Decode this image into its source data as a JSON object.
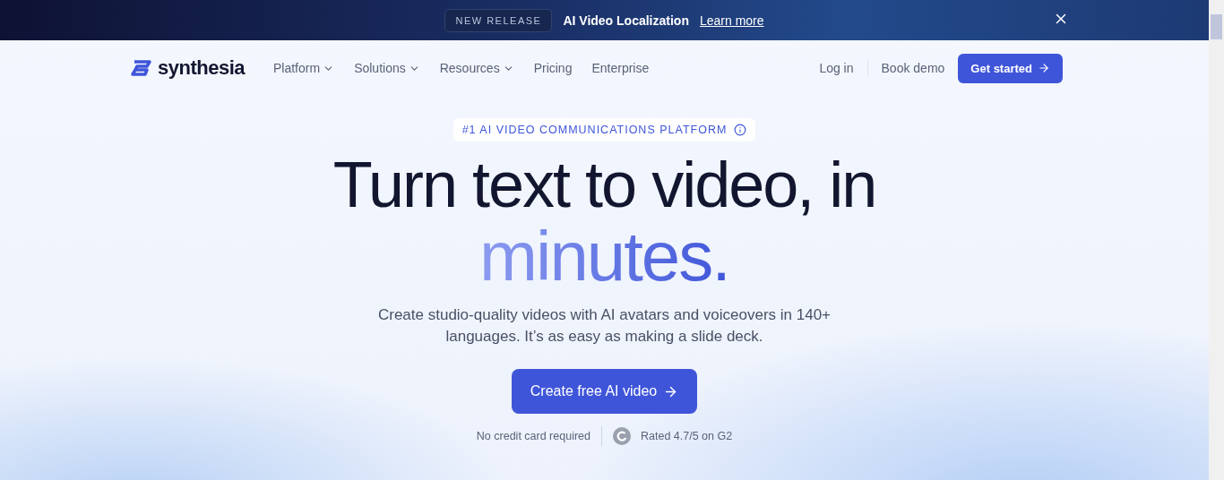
{
  "announcement": {
    "badge": "NEW RELEASE",
    "text": "AI Video Localization",
    "link": "Learn more"
  },
  "nav": {
    "logo": "synthesia",
    "items": [
      {
        "label": "Platform",
        "has_menu": true
      },
      {
        "label": "Solutions",
        "has_menu": true
      },
      {
        "label": "Resources",
        "has_menu": true
      },
      {
        "label": "Pricing",
        "has_menu": false
      },
      {
        "label": "Enterprise",
        "has_menu": false
      }
    ],
    "login": "Log in",
    "demo": "Book demo",
    "cta": "Get started"
  },
  "hero": {
    "eyebrow": "#1 AI VIDEO COMMUNICATIONS PLATFORM",
    "headline": "Turn text to video, in",
    "highlight": "minutes.",
    "subtitle": "Create studio-quality videos with AI avatars and voiceovers in 140+ languages. It’s as easy as making a slide deck.",
    "cta": "Create free AI video",
    "note": "No credit card required",
    "rating": "Rated 4.7/5 on G2"
  }
}
